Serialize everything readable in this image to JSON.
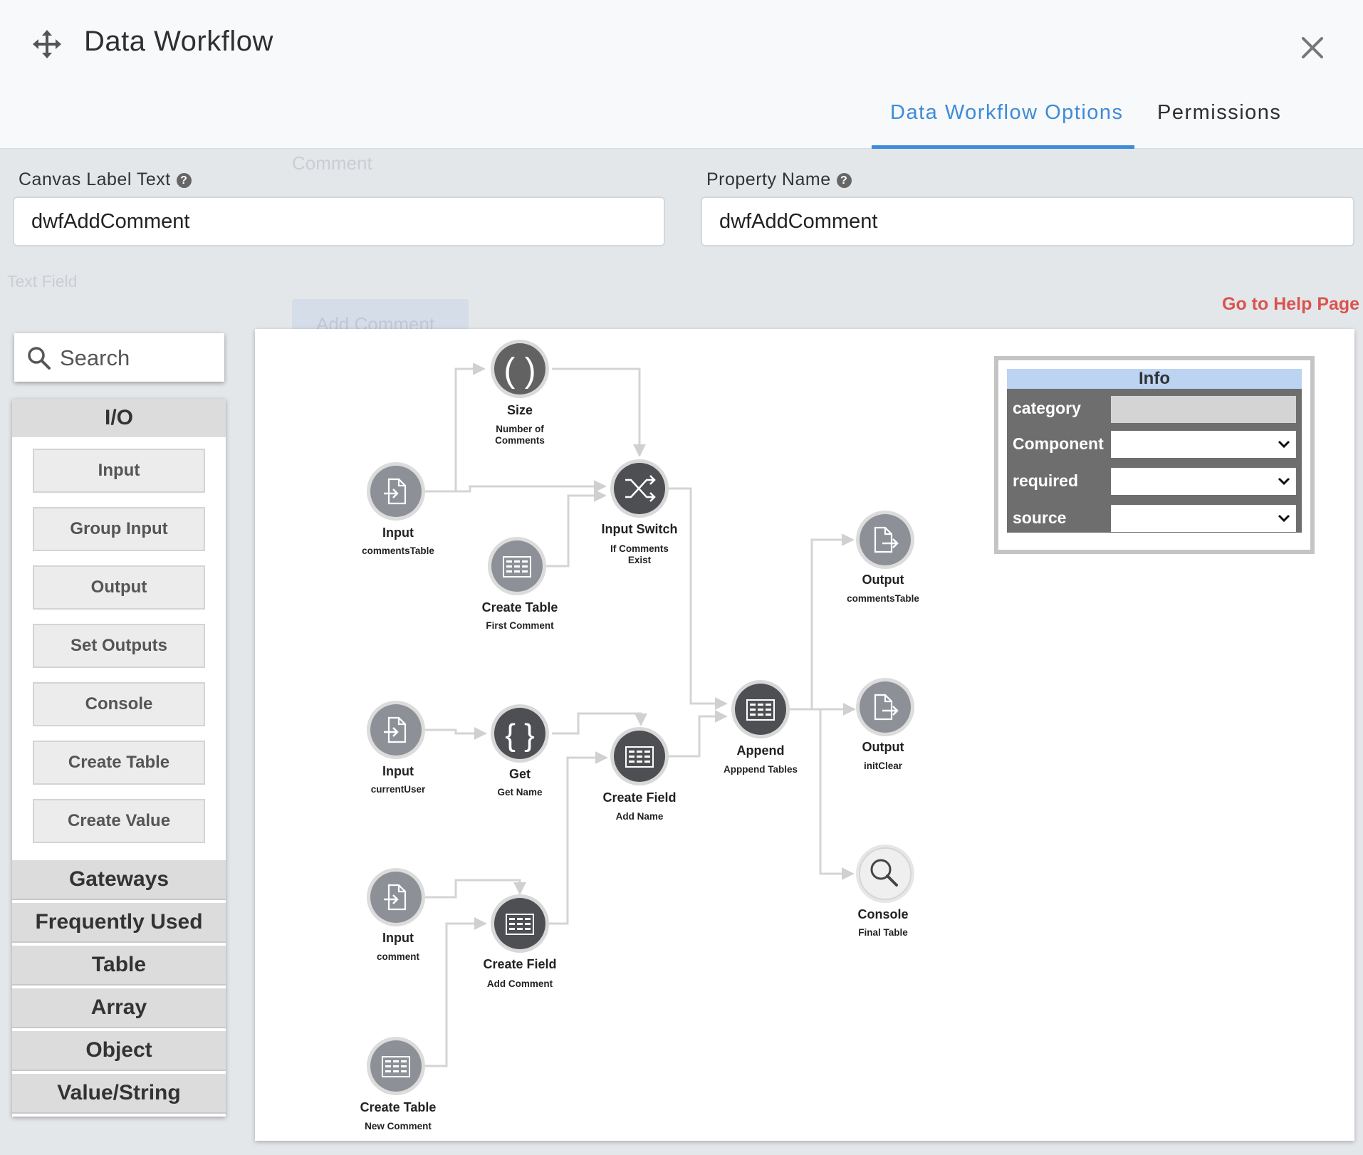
{
  "header": {
    "title": "Data Workflow",
    "tabs": [
      {
        "label": "Data Workflow Options",
        "active": true
      },
      {
        "label": "Permissions",
        "active": false
      }
    ]
  },
  "background": {
    "ghost_texts": [
      "Comment",
      "Text Field",
      "Add Comment"
    ]
  },
  "form": {
    "canvas_label_text": {
      "label": "Canvas Label Text",
      "value": "dwfAddComment"
    },
    "property_name": {
      "label": "Property Name",
      "value": "dwfAddComment"
    },
    "help_link": "Go to Help Page"
  },
  "palette": {
    "search_placeholder": "Search",
    "active_category": "I/O",
    "io_items": [
      "Input",
      "Group Input",
      "Output",
      "Set Outputs",
      "Console",
      "Create Table",
      "Create Value"
    ],
    "categories": [
      "Gateways",
      "Frequently Used",
      "Table",
      "Array",
      "Object",
      "Value/String"
    ]
  },
  "info_panel": {
    "title": "Info",
    "rows": [
      {
        "label": "category",
        "value": "",
        "type": "readonly"
      },
      {
        "label": "Component",
        "value": "",
        "type": "select"
      },
      {
        "label": "required",
        "value": "",
        "type": "select"
      },
      {
        "label": "source",
        "value": "",
        "type": "select"
      }
    ]
  },
  "workflow": {
    "nodes": [
      {
        "id": "size",
        "title": "Size",
        "subtitle": [
          "Number of",
          "Comments"
        ],
        "icon": "parentheses-icon"
      },
      {
        "id": "input-comments",
        "title": "Input",
        "subtitle": [
          "commentsTable"
        ],
        "icon": "input-icon"
      },
      {
        "id": "input-switch",
        "title": "Input Switch",
        "subtitle": [
          "If Comments",
          "Exist"
        ],
        "icon": "shuffle-icon"
      },
      {
        "id": "create-table-first",
        "title": "Create Table",
        "subtitle": [
          "First Comment"
        ],
        "icon": "table-icon"
      },
      {
        "id": "output-comments",
        "title": "Output",
        "subtitle": [
          "commentsTable"
        ],
        "icon": "output-icon"
      },
      {
        "id": "input-user",
        "title": "Input",
        "subtitle": [
          "currentUser"
        ],
        "icon": "input-icon"
      },
      {
        "id": "get",
        "title": "Get",
        "subtitle": [
          "Get Name"
        ],
        "icon": "braces-icon"
      },
      {
        "id": "create-field-name",
        "title": "Create Field",
        "subtitle": [
          "Add Name"
        ],
        "icon": "table-icon"
      },
      {
        "id": "append",
        "title": "Append",
        "subtitle": [
          "Apppend Tables"
        ],
        "icon": "table-icon"
      },
      {
        "id": "output-init",
        "title": "Output",
        "subtitle": [
          "initClear"
        ],
        "icon": "output-icon"
      },
      {
        "id": "input-comment",
        "title": "Input",
        "subtitle": [
          "comment"
        ],
        "icon": "input-icon"
      },
      {
        "id": "create-field-comment",
        "title": "Create Field",
        "subtitle": [
          "Add Comment"
        ],
        "icon": "table-icon"
      },
      {
        "id": "console",
        "title": "Console",
        "subtitle": [
          "Final Table"
        ],
        "icon": "magnifier-icon"
      },
      {
        "id": "create-table-new",
        "title": "Create Table",
        "subtitle": [
          "New Comment"
        ],
        "icon": "table-icon"
      }
    ]
  }
}
